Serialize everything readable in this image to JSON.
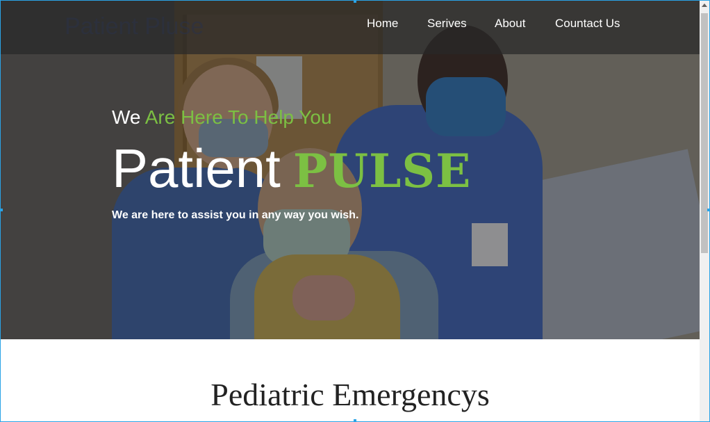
{
  "nav": {
    "logo": "Patient Pluse",
    "items": [
      "Home",
      "Serives",
      "About",
      "Countact Us"
    ]
  },
  "hero": {
    "tagline_white": "We",
    "tagline_green": "Are Here To Help You",
    "brand_main": "Patient",
    "brand_accent": "PULSE",
    "subline": "We are here to assist you in any way you wish."
  },
  "section": {
    "title": "Pediatric Emergencys"
  },
  "colors": {
    "accent_green": "#7cc043",
    "nav_bg": "#282828",
    "frame_border": "#2aa3e6"
  }
}
